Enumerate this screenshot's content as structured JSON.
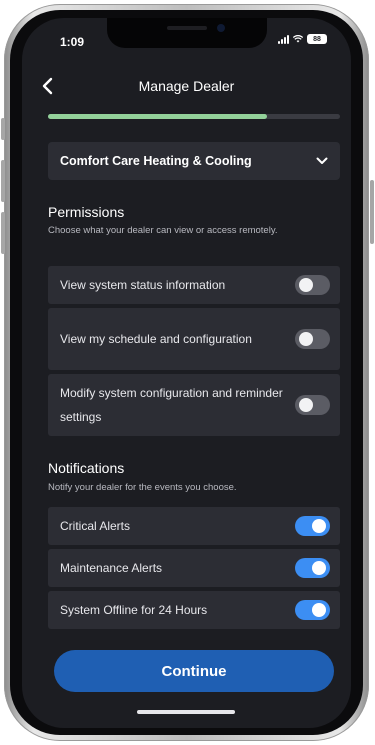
{
  "status_bar": {
    "time": "1:09",
    "battery": "88"
  },
  "nav": {
    "title": "Manage Dealer"
  },
  "progress": {
    "value": 0.75,
    "color": "#93d19a"
  },
  "dealer": {
    "selected": "Comfort Care Heating & Cooling"
  },
  "permissions": {
    "title": "Permissions",
    "description": "Choose what your dealer can view or access remotely.",
    "items": [
      {
        "label": "View system status information",
        "enabled": false
      },
      {
        "label": "View my schedule and configuration",
        "enabled": false
      },
      {
        "label": "Modify system configuration and reminder settings",
        "enabled": false
      }
    ]
  },
  "notifications": {
    "title": "Notifications",
    "description": "Notify your dealer for the events you choose.",
    "items": [
      {
        "label": "Critical Alerts",
        "enabled": true
      },
      {
        "label": "Maintenance Alerts",
        "enabled": true
      },
      {
        "label": "System Offline for 24 Hours",
        "enabled": true
      }
    ]
  },
  "continue_button": {
    "label": "Continue"
  },
  "colors": {
    "background": "#1c1d22",
    "card": "#2c2d34",
    "toggle_on": "#3c8ef3",
    "toggle_off": "#5b5c64",
    "primary_button": "#1f5fb3"
  },
  "icons": [
    "back-chevron-icon",
    "chevron-down-icon",
    "signal-icon",
    "wifi-icon",
    "battery-icon"
  ]
}
